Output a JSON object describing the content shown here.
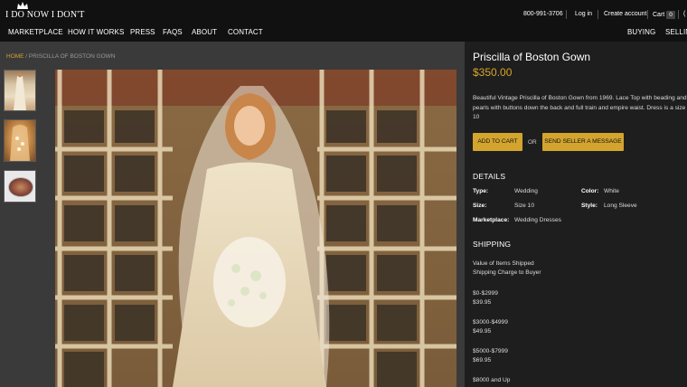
{
  "header": {
    "logo_text": "I DO NOW I DON'T",
    "phone": "800-991-3706",
    "login": "Log in",
    "create_account": "Create account",
    "cart_label": "Cart",
    "cart_count": "0",
    "nav": [
      "MARKETPLACE",
      "HOW IT WORKS",
      "PRESS",
      "FAQS",
      "ABOUT",
      "CONTACT"
    ],
    "nav_right": [
      "BUYING",
      "SELLIN"
    ]
  },
  "breadcrumb": {
    "home": "HOME",
    "sep": " / ",
    "current": "PRISCILLA OF BOSTON GOWN"
  },
  "product": {
    "title": "Priscilla of Boston Gown",
    "price": "$350.00",
    "description": "Beautiful Vintage Priscilla of Boston Gown from 1969. Lace Top with beading and pearls with buttons down the back and full train and empire waist. Dress is a size 10",
    "add_to_cart": "ADD TO CART",
    "or": "OR",
    "send_message": "SEND SELLER A MESSAGE"
  },
  "details": {
    "heading": "DETAILS",
    "type_label": "Type:",
    "type_value": "Wedding",
    "color_label": "Color:",
    "color_value": "White",
    "size_label": "Size:",
    "size_value": "Size 10",
    "style_label": "Style:",
    "style_value": "Long Sleeve",
    "marketplace_label": "Marketplace:",
    "marketplace_value": "Wedding Dresses"
  },
  "shipping": {
    "heading": "SHIPPING",
    "col1": "Value of Items Shipped",
    "col2": "Shipping Charge to Buyer",
    "tiers": [
      {
        "range": "$0-$2999",
        "charge": "$39.95"
      },
      {
        "range": "$3000-$4999",
        "charge": "$49.95"
      },
      {
        "range": "$5000-$7999",
        "charge": "$69.95"
      },
      {
        "range": "$8000 and Up",
        "charge": ""
      }
    ]
  },
  "colors": {
    "accent_gold": "#d3a52f",
    "header_bg": "#111111",
    "main_bg": "#3a3a3a",
    "side_bg": "#1e1e1e"
  },
  "icons": [
    "crown-icon",
    "cart-icon"
  ]
}
